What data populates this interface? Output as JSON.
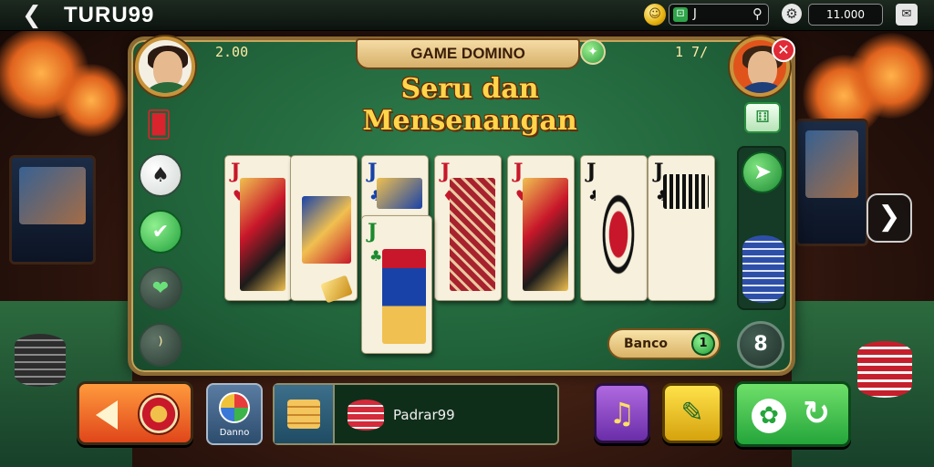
{
  "app": {
    "brand": "TURU99",
    "balance_value": "J",
    "chips_total": "11.000"
  },
  "table": {
    "title": "GAME DOMINO",
    "subtitle": "Seru dan Mensenangan",
    "score_left": "2.00",
    "score_right": "1 7/",
    "bonus_label": "Banco",
    "bonus_count": "1",
    "round_label": "8"
  },
  "cards": [
    {
      "rank": "J",
      "suit": "♥",
      "color": "#c8172a"
    },
    {
      "rank": "",
      "suit": "",
      "color": "#1842a8"
    },
    {
      "rank": "J",
      "suit": "♣",
      "color": "#1842a8"
    },
    {
      "rank": "J",
      "suit": "♣",
      "color": "#1c8a2e"
    },
    {
      "rank": "J",
      "suit": "♦",
      "color": "#c8172a"
    },
    {
      "rank": "J",
      "suit": "♥",
      "color": "#c8172a"
    },
    {
      "rank": "J",
      "suit": "♣",
      "color": "#111111"
    },
    {
      "rank": "J",
      "suit": "♣",
      "color": "#111111"
    }
  ],
  "bottom": {
    "domino_label": "Danno",
    "player_name": "Padrar99"
  },
  "icons": {
    "back": "back-arrow-icon",
    "coin": "coin-icon",
    "gear": "gear-icon",
    "chat": "chat-icon",
    "close": "close-icon",
    "next": "chevron-right-icon"
  },
  "colors": {
    "felt": "#2f7f4d",
    "frame": "#8b6a33",
    "title_gold": "#ffd54a",
    "play_orange": "#e0461a",
    "action_green": "#24a53a"
  }
}
